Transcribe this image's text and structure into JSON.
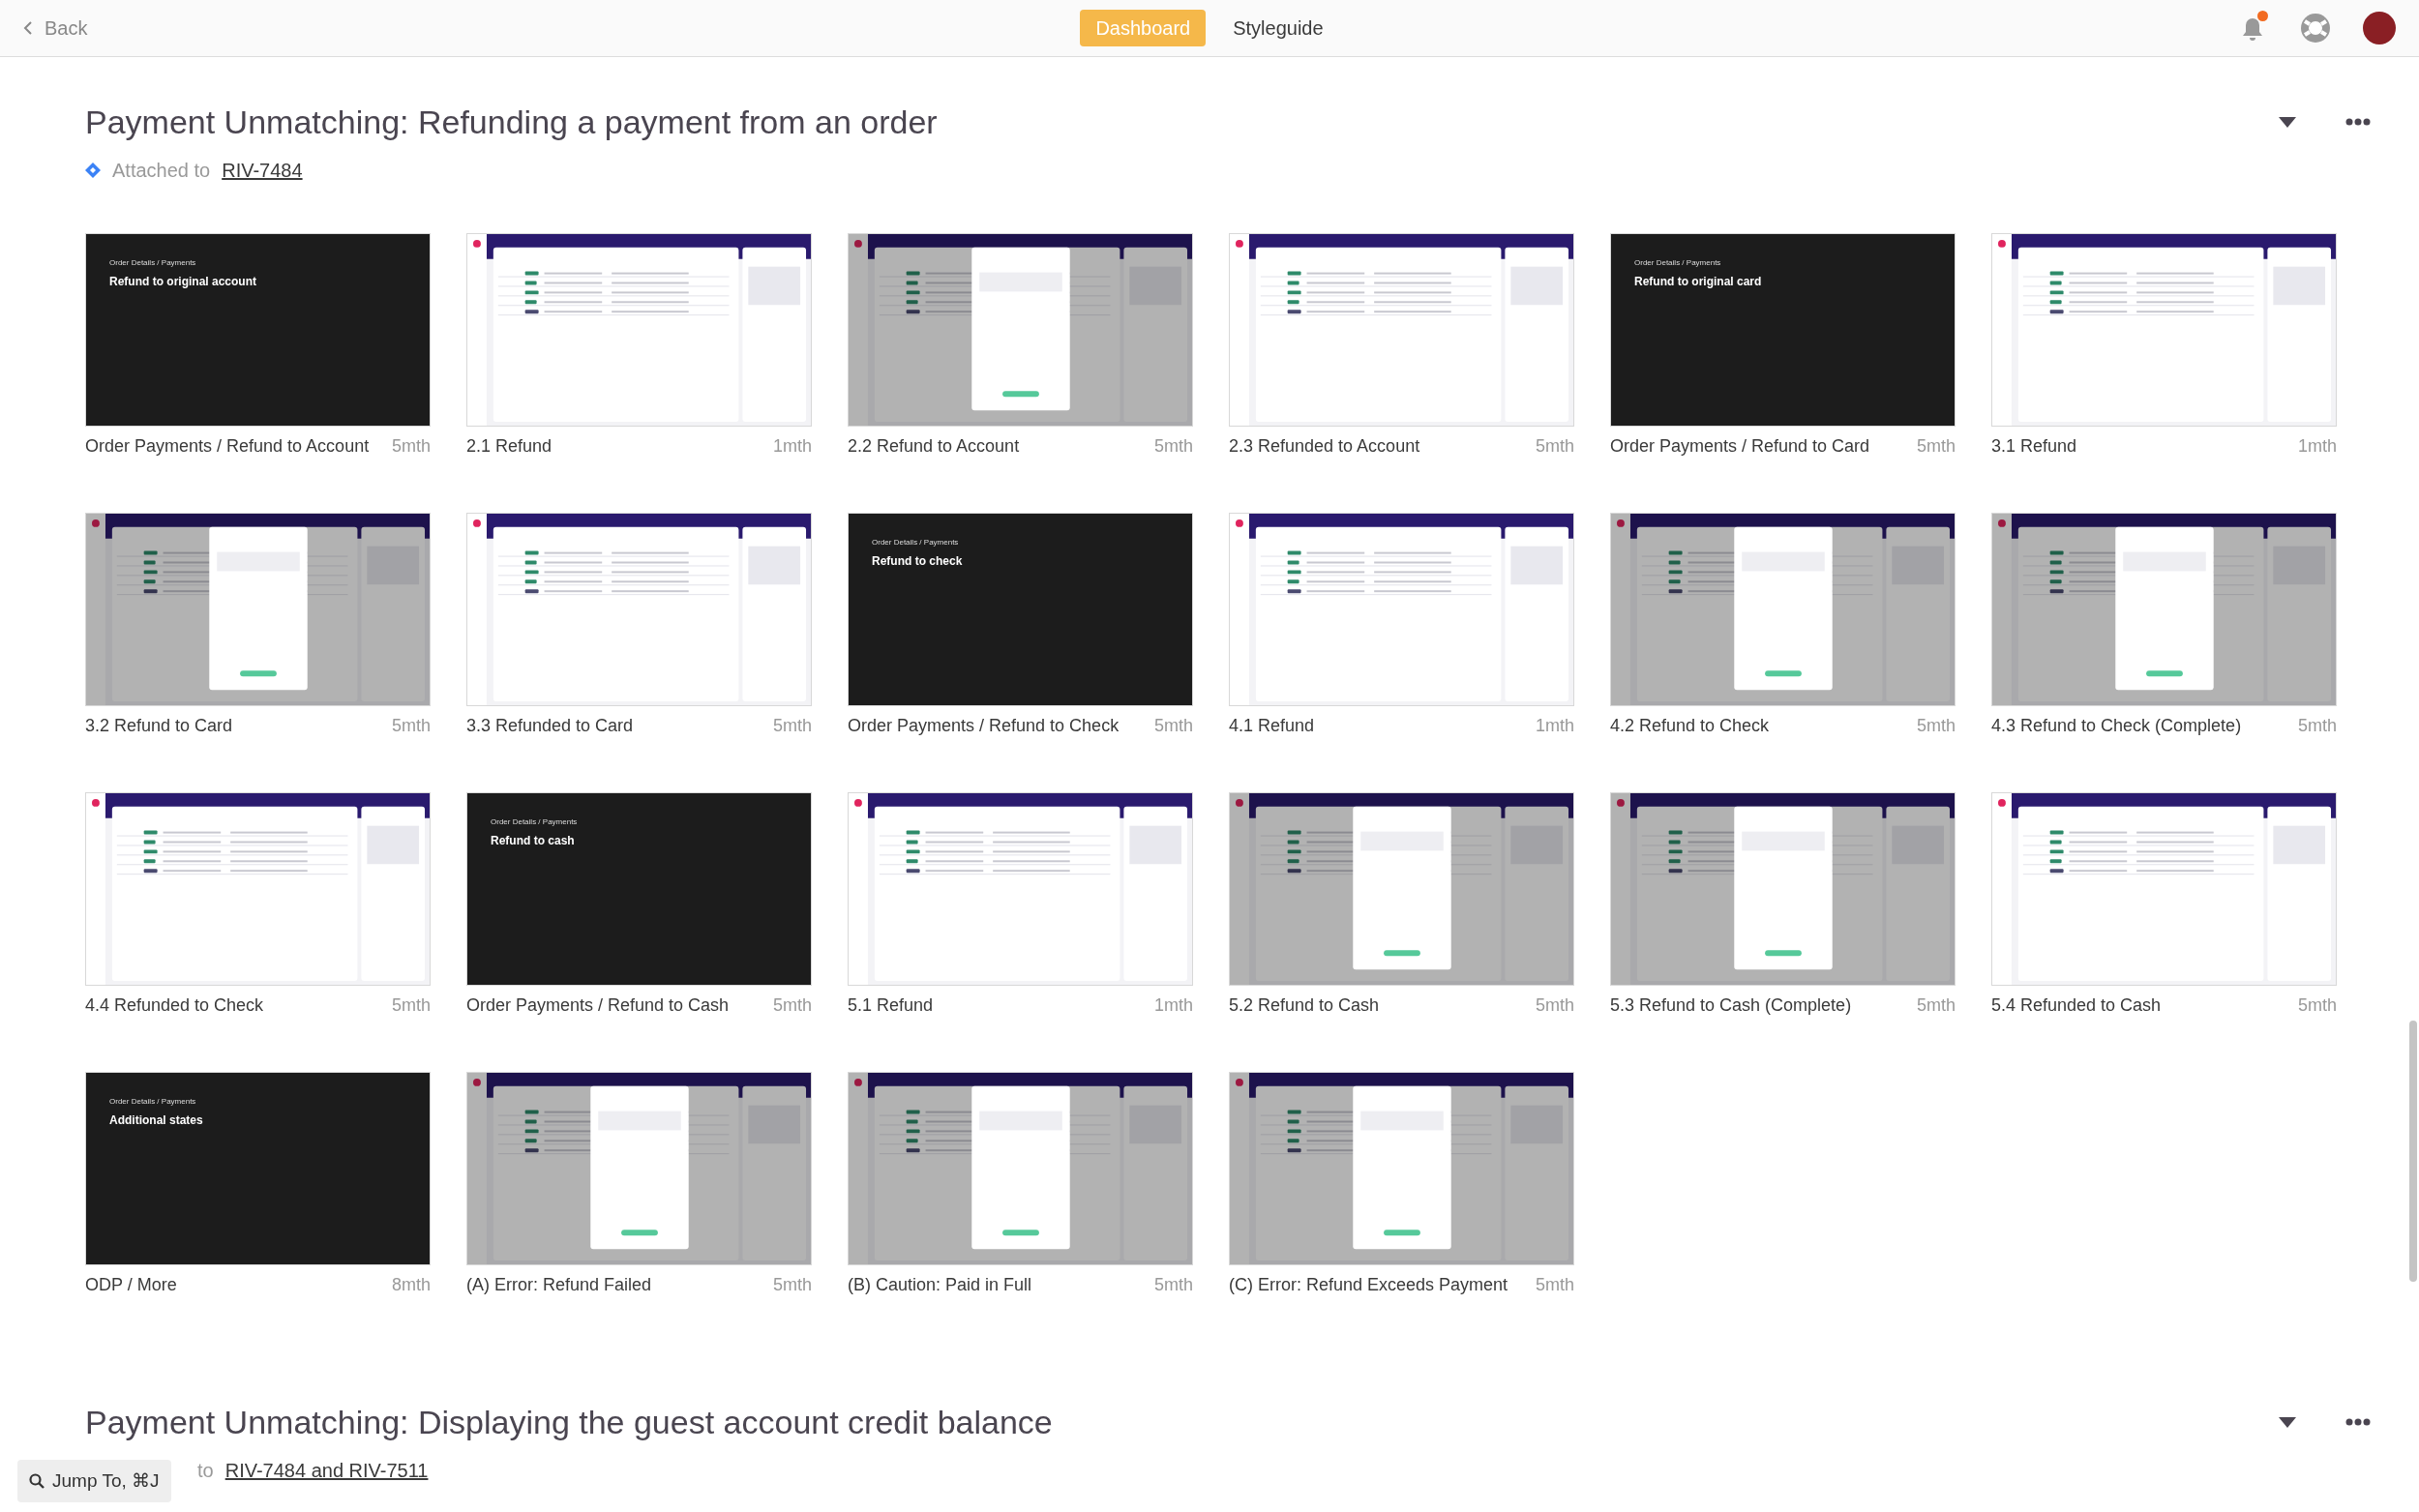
{
  "top_bar": {
    "back": "Back",
    "tabs": [
      {
        "label": "Dashboard",
        "selected": true
      },
      {
        "label": "Styleguide",
        "selected": false
      }
    ],
    "notifications_unread": true
  },
  "sections": [
    {
      "title": "Payment Unmatching: Refunding a payment from an order",
      "attached_label": "Attached to",
      "attached_link": "RIV-7484",
      "screens": [
        {
          "kind": "dark",
          "breadcrumb": "Order Details / Payments",
          "heading": "Refund to original account",
          "name": "Order Payments / Refund to Account",
          "age": "5mth"
        },
        {
          "kind": "table",
          "name": "2.1 Refund",
          "age": "1mth"
        },
        {
          "kind": "modal",
          "name": "2.2 Refund to Account",
          "age": "5mth"
        },
        {
          "kind": "table",
          "name": "2.3 Refunded to Account",
          "age": "5mth"
        },
        {
          "kind": "dark",
          "breadcrumb": "Order Details / Payments",
          "heading": "Refund to original card",
          "name": "Order Payments / Refund to Card",
          "age": "5mth"
        },
        {
          "kind": "table",
          "name": "3.1 Refund",
          "age": "1mth"
        },
        {
          "kind": "modal",
          "name": "3.2 Refund to Card",
          "age": "5mth"
        },
        {
          "kind": "table",
          "name": "3.3 Refunded to Card",
          "age": "5mth"
        },
        {
          "kind": "dark",
          "breadcrumb": "Order Details / Payments",
          "heading": "Refund to check",
          "name": "Order Payments / Refund to Check",
          "age": "5mth"
        },
        {
          "kind": "table",
          "name": "4.1 Refund",
          "age": "1mth"
        },
        {
          "kind": "modal",
          "name": "4.2 Refund to Check",
          "age": "5mth"
        },
        {
          "kind": "modal",
          "name": "4.3 Refund to Check (Complete)",
          "age": "5mth"
        },
        {
          "kind": "table",
          "name": "4.4 Refunded to Check",
          "age": "5mth"
        },
        {
          "kind": "dark",
          "breadcrumb": "Order Details / Payments",
          "heading": "Refund to cash",
          "name": "Order Payments / Refund to Cash",
          "age": "5mth"
        },
        {
          "kind": "table",
          "name": "5.1 Refund",
          "age": "1mth"
        },
        {
          "kind": "modal",
          "name": "5.2 Refund to Cash",
          "age": "5mth"
        },
        {
          "kind": "modal",
          "name": "5.3 Refund to Cash (Complete)",
          "age": "5mth"
        },
        {
          "kind": "table",
          "name": "5.4 Refunded to Cash",
          "age": "5mth"
        },
        {
          "kind": "dark",
          "breadcrumb": "Order Details / Payments",
          "heading": "Additional states",
          "name": "ODP / More",
          "age": "8mth"
        },
        {
          "kind": "modal",
          "name": "(A) Error: Refund Failed",
          "age": "5mth"
        },
        {
          "kind": "modal",
          "name": "(B) Caution: Paid in Full",
          "age": "5mth"
        },
        {
          "kind": "modal",
          "name": "(C) Error: Refund Exceeds Payment",
          "age": "5mth"
        }
      ]
    },
    {
      "title": "Payment Unmatching: Displaying the guest account credit balance",
      "attached_label": "to",
      "attached_link": "RIV-7484 and RIV-7511"
    }
  ],
  "jump_to": "Jump To, ⌘J"
}
